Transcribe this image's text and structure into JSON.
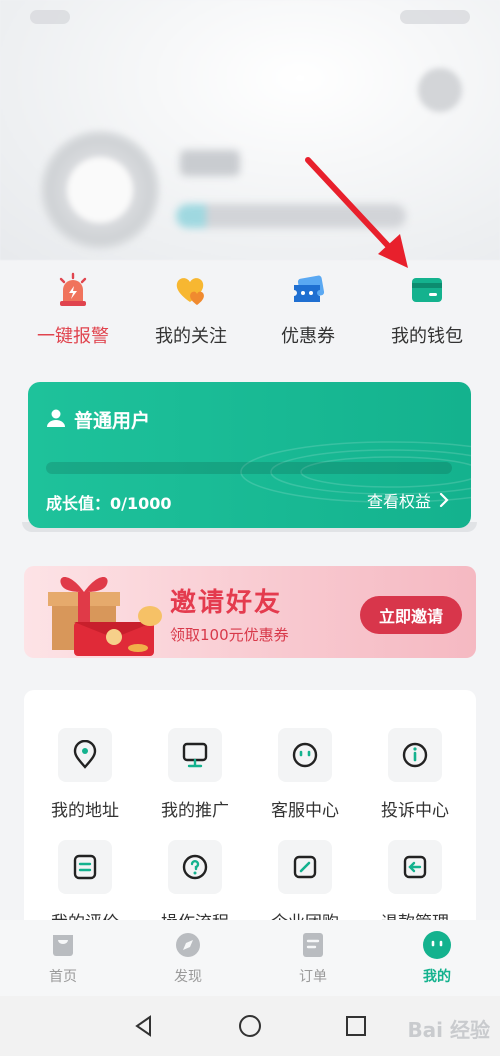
{
  "quick_actions": [
    {
      "label": "一键报警",
      "icon": "alarm-icon",
      "color": "#e0444e"
    },
    {
      "label": "我的关注",
      "icon": "heart-icon",
      "color": "#f5a623"
    },
    {
      "label": "优惠券",
      "icon": "coupon-icon",
      "color": "#2f8fe0"
    },
    {
      "label": "我的钱包",
      "icon": "wallet-icon",
      "color": "#14b28e"
    }
  ],
  "member": {
    "title": "普通用户",
    "growth": "成长值：0/1000",
    "progress_fraction": 0,
    "rights_link": "查看权益",
    "accent": "#1ec29b"
  },
  "invite": {
    "title": "邀请好友",
    "subtitle": "领取100元优惠券",
    "button": "立即邀请"
  },
  "services": [
    {
      "label": "我的地址",
      "icon": "location-icon"
    },
    {
      "label": "我的推广",
      "icon": "monitor-icon"
    },
    {
      "label": "客服中心",
      "icon": "service-icon"
    },
    {
      "label": "投诉中心",
      "icon": "info-icon"
    },
    {
      "label": "我的评价",
      "icon": "review-icon"
    },
    {
      "label": "操作流程",
      "icon": "question-icon"
    },
    {
      "label": "企业团购",
      "icon": "edit-icon"
    },
    {
      "label": "退款管理",
      "icon": "refund-icon"
    }
  ],
  "nav": [
    {
      "label": "首页",
      "icon": "home-icon"
    },
    {
      "label": "发现",
      "icon": "discover-icon"
    },
    {
      "label": "订单",
      "icon": "order-icon"
    },
    {
      "label": "我的",
      "icon": "mine-icon",
      "active": true
    }
  ],
  "watermark": "Bai 经验"
}
